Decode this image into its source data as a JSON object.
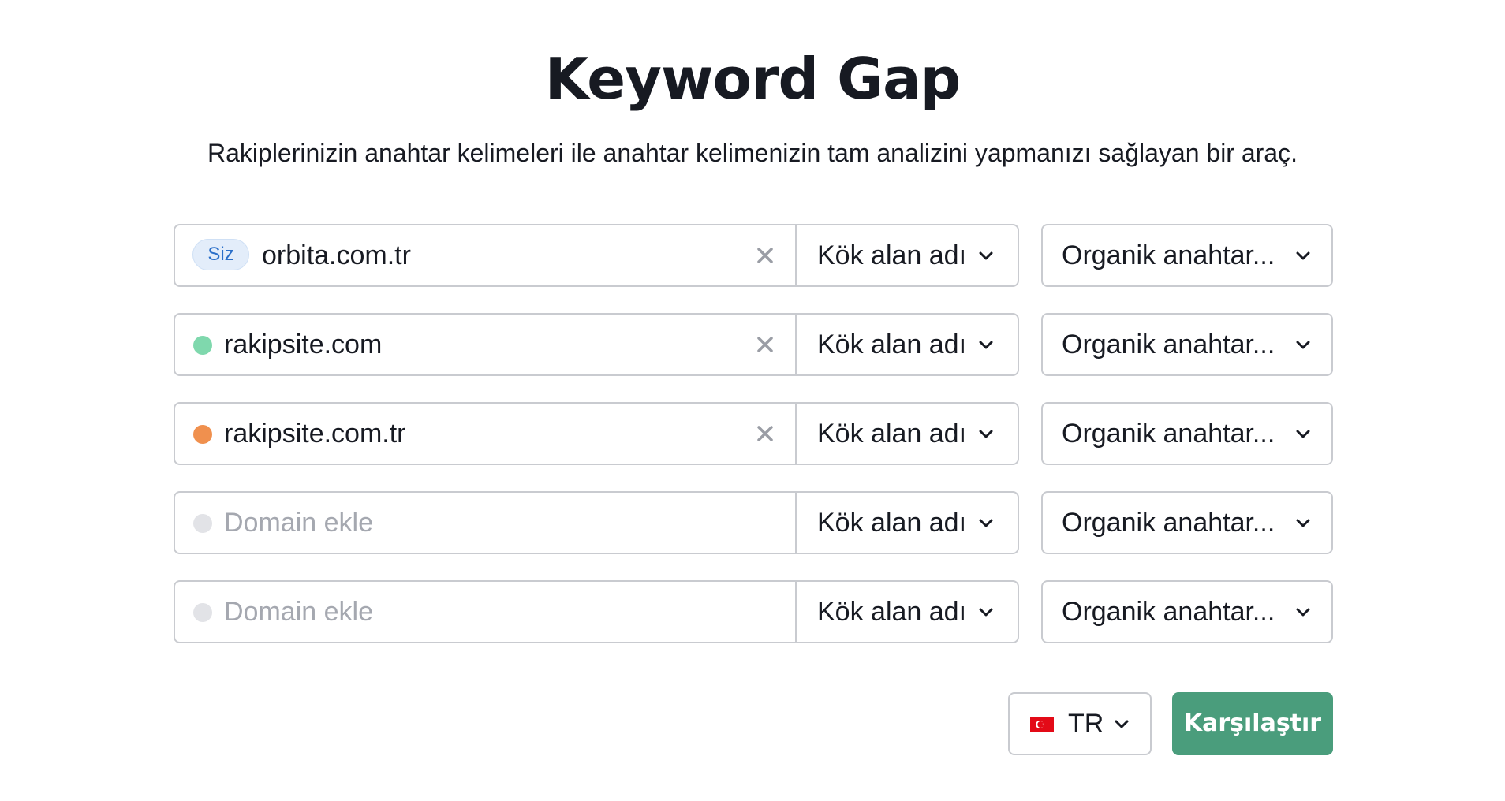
{
  "header": {
    "title": "Keyword Gap",
    "subtitle": "Rakiplerinizin anahtar kelimeleri ile anahtar kelimenizin tam analizini yapmanızı sağlayan bir araç."
  },
  "rows": [
    {
      "badge": "Siz",
      "domain": "orbita.com.tr",
      "placeholder": "",
      "dot_color": "",
      "scope": "Kök alan adı",
      "type": "Organik anahtar..."
    },
    {
      "badge": "",
      "domain": "rakipsite.com",
      "placeholder": "",
      "dot_color": "#7fd8ad",
      "scope": "Kök alan adı",
      "type": "Organik anahtar..."
    },
    {
      "badge": "",
      "domain": "rakipsite.com.tr",
      "placeholder": "",
      "dot_color": "#f0904e",
      "scope": "Kök alan adı",
      "type": "Organik anahtar..."
    },
    {
      "badge": "",
      "domain": "",
      "placeholder": "Domain ekle",
      "dot_color": "#e2e3e7",
      "scope": "Kök alan adı",
      "type": "Organik anahtar..."
    },
    {
      "badge": "",
      "domain": "",
      "placeholder": "Domain ekle",
      "dot_color": "#e2e3e7",
      "scope": "Kök alan adı",
      "type": "Organik anahtar..."
    }
  ],
  "database": {
    "label": "TR",
    "flag_icon": "turkey-flag-icon"
  },
  "actions": {
    "compare_label": "Karşılaştır"
  },
  "colors": {
    "accent_button": "#4a9d7c",
    "border": "#c9cbd0",
    "badge_bg": "#e3edfa",
    "badge_text": "#2a6fc9"
  }
}
